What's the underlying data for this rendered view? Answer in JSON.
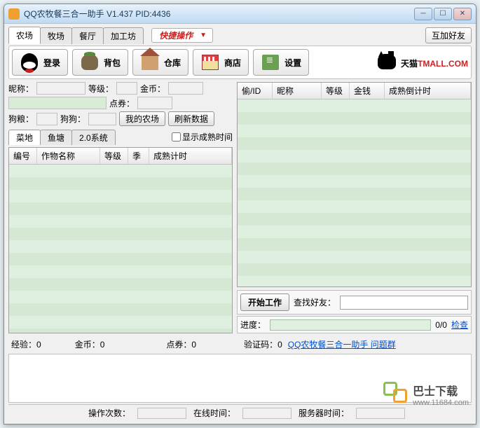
{
  "titlebar": {
    "title": "QQ农牧餐三合一助手  V1.437      PID:4436"
  },
  "maintabs": {
    "farm": "农场",
    "pasture": "牧场",
    "restaurant": "餐厅",
    "workshop": "加工坊"
  },
  "quickop": "快捷操作",
  "add_friend": "互加好友",
  "toolbar": {
    "login": "登录",
    "bag": "背包",
    "warehouse": "仓库",
    "shop": "商店",
    "settings": "设置"
  },
  "tmall": {
    "cn": "天猫",
    "en": "TMALL.COM"
  },
  "left": {
    "nickname_label": "昵称：",
    "level_label": "等级：",
    "gold_label": "金币：",
    "coupon_label": "点券：",
    "dogfood_label": "狗粮：",
    "dog_label": "狗狗：",
    "myfarm_btn": "我的农场",
    "refresh_btn": "刷新数据",
    "subtabs": {
      "field": "菜地",
      "pond": "鱼塘",
      "sys20": "2.0系统"
    },
    "show_mature": "显示成熟时间",
    "columns": {
      "id": "编号",
      "crop": "作物名称",
      "level": "等级",
      "season": "季",
      "mature": "成熟计时"
    }
  },
  "right": {
    "columns": {
      "steal": "偷/ID",
      "nickname": "昵称",
      "level": "等级",
      "money": "金钱",
      "countdown": "成熟倒计时"
    },
    "start_work": "开始工作",
    "find_friend": "查找好友：",
    "progress_label": "进度：",
    "progress_value": "0/0",
    "check": "检查"
  },
  "status": {
    "exp": "经验：0",
    "gold": "金币：0",
    "coupon": "点券：0",
    "captcha": "验证码：0",
    "help_link": "QQ农牧餐三合一助手 问题群"
  },
  "bottom": {
    "ops": "操作次数：",
    "online": "在线时间：",
    "server": "服务器时间："
  },
  "watermark": {
    "text": "巴士下载",
    "url": "www.11684.com"
  }
}
